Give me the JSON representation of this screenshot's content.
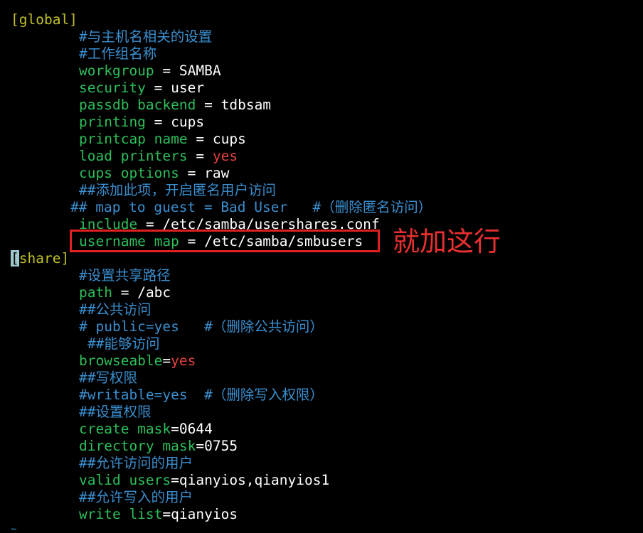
{
  "colors": {
    "background": "#000000",
    "section_header": "#c0c028",
    "key": "#2cbf5a",
    "value": "#ffffff",
    "comment": "#3a8fd0",
    "boolean_yes": "#e8413f",
    "annotation": "#e83030",
    "highlight_border": "#e02020"
  },
  "lines": [
    {
      "segments": [
        {
          "text": "[global]"
        }
      ]
    },
    {
      "segments": [
        {
          "text": "#与主机名相关的设置"
        }
      ]
    },
    {
      "segments": [
        {
          "text": "#工作组名称"
        }
      ]
    },
    {
      "segments": [
        {
          "text": "workgroup"
        },
        {
          "text": " = "
        },
        {
          "text": "SAMBA"
        }
      ]
    },
    {
      "segments": [
        {
          "text": "security"
        },
        {
          "text": " = "
        },
        {
          "text": "user"
        }
      ]
    },
    {
      "segments": [
        {
          "text": "passdb backend"
        },
        {
          "text": " = "
        },
        {
          "text": "tdbsam"
        }
      ]
    },
    {
      "segments": [
        {
          "text": "printing"
        },
        {
          "text": " = "
        },
        {
          "text": "cups"
        }
      ]
    },
    {
      "segments": [
        {
          "text": "printcap name"
        },
        {
          "text": " = "
        },
        {
          "text": "cups"
        }
      ]
    },
    {
      "segments": [
        {
          "text": "load printers"
        },
        {
          "text": " = "
        },
        {
          "text": "yes"
        }
      ]
    },
    {
      "segments": [
        {
          "text": "cups options"
        },
        {
          "text": " = "
        },
        {
          "text": "raw"
        }
      ]
    },
    {
      "segments": [
        {
          "text": "##添加此项，开启匿名用户访问"
        }
      ]
    },
    {
      "segments": [
        {
          "text": "## map to guest = Bad User   #（删除匿名访问）"
        }
      ]
    },
    {
      "segments": [
        {
          "text": "include"
        },
        {
          "text": " = "
        },
        {
          "text": "/etc/samba/usershares.conf"
        }
      ]
    },
    {
      "segments": [
        {
          "text": "username map"
        },
        {
          "text": " = "
        },
        {
          "text": "/etc/samba/smbusers"
        }
      ]
    },
    {
      "segments": [
        {
          "text": "["
        },
        {
          "text": "share"
        },
        {
          "text": "]"
        }
      ]
    },
    {
      "segments": [
        {
          "text": "#设置共享路径"
        }
      ]
    },
    {
      "segments": [
        {
          "text": "path"
        },
        {
          "text": " = "
        },
        {
          "text": "/abc"
        }
      ]
    },
    {
      "segments": [
        {
          "text": "##公共访问"
        }
      ]
    },
    {
      "segments": [
        {
          "text": "# public=yes   #（删除公共访问）"
        }
      ]
    },
    {
      "segments": [
        {
          "text": "##能够访问"
        }
      ]
    },
    {
      "segments": [
        {
          "text": "browseable"
        },
        {
          "text": "="
        },
        {
          "text": "yes"
        }
      ]
    },
    {
      "segments": [
        {
          "text": "##写权限"
        }
      ]
    },
    {
      "segments": [
        {
          "text": "#writable=yes  #（删除写入权限）"
        }
      ]
    },
    {
      "segments": [
        {
          "text": "##设置权限"
        }
      ]
    },
    {
      "segments": [
        {
          "text": "create mask"
        },
        {
          "text": "="
        },
        {
          "text": "0644"
        }
      ]
    },
    {
      "segments": [
        {
          "text": "directory mask"
        },
        {
          "text": "="
        },
        {
          "text": "0755"
        }
      ]
    },
    {
      "segments": [
        {
          "text": "##允许访问的用户"
        }
      ]
    },
    {
      "segments": [
        {
          "text": "valid users"
        },
        {
          "text": "="
        },
        {
          "text": "qianyios,qianyios1"
        }
      ]
    },
    {
      "segments": [
        {
          "text": "##允许写入的用户"
        }
      ]
    },
    {
      "segments": [
        {
          "text": "write list"
        },
        {
          "text": "="
        },
        {
          "text": "qianyios"
        }
      ]
    }
  ],
  "annotation": {
    "text": "就加这行"
  },
  "status_glyph": "~"
}
